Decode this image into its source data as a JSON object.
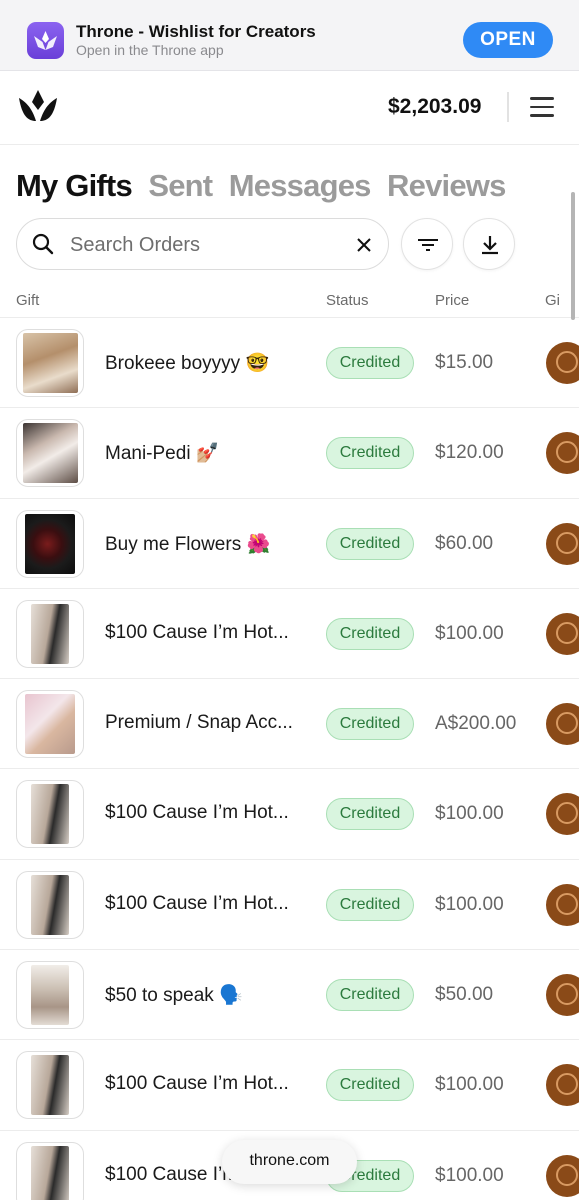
{
  "banner": {
    "title": "Throne - Wishlist for Creators",
    "subtitle": "Open in the Throne app",
    "open_label": "OPEN",
    "icon": "throne-app-icon"
  },
  "header": {
    "balance": "$2,203.09",
    "logo_icon": "throne-crown-icon",
    "menu_icon": "hamburger-menu-icon"
  },
  "tabs": [
    {
      "label": "My Gifts",
      "active": true
    },
    {
      "label": "Sent",
      "active": false
    },
    {
      "label": "Messages",
      "active": false
    },
    {
      "label": "Reviews",
      "active": false
    }
  ],
  "search": {
    "placeholder": "Search Orders",
    "value": "",
    "search_icon": "search-icon",
    "clear_icon": "close-icon",
    "filter_icon": "filter-icon",
    "download_icon": "download-icon"
  },
  "table": {
    "columns": [
      "Gift",
      "Status",
      "Price",
      "Gi"
    ],
    "rows": [
      {
        "name": "Brokeee boyyyy 🤓",
        "status": "Credited",
        "price": "$15.00"
      },
      {
        "name": "Mani-Pedi 💅🏼",
        "status": "Credited",
        "price": "$120.00"
      },
      {
        "name": "Buy me Flowers 🌺",
        "status": "Credited",
        "price": "$60.00"
      },
      {
        "name": "$100 Cause I’m Hot...",
        "status": "Credited",
        "price": "$100.00"
      },
      {
        "name": "Premium / Snap Acc...",
        "status": "Credited",
        "price": "A$200.00"
      },
      {
        "name": "$100 Cause I’m Hot...",
        "status": "Credited",
        "price": "$100.00"
      },
      {
        "name": "$100 Cause I’m Hot...",
        "status": "Credited",
        "price": "$100.00"
      },
      {
        "name": "$50 to speak 🗣️",
        "status": "Credited",
        "price": "$50.00"
      },
      {
        "name": "$100 Cause I’m Hot...",
        "status": "Credited",
        "price": "$100.00"
      },
      {
        "name": "$100 Cause I’m Hot...",
        "status": "Credited",
        "price": "$100.00"
      }
    ]
  },
  "status_color": "#2b7a3d",
  "status_bg": "#d9f5df",
  "accent_color": "#2f8af5",
  "footer": {
    "url": "throne.com"
  }
}
